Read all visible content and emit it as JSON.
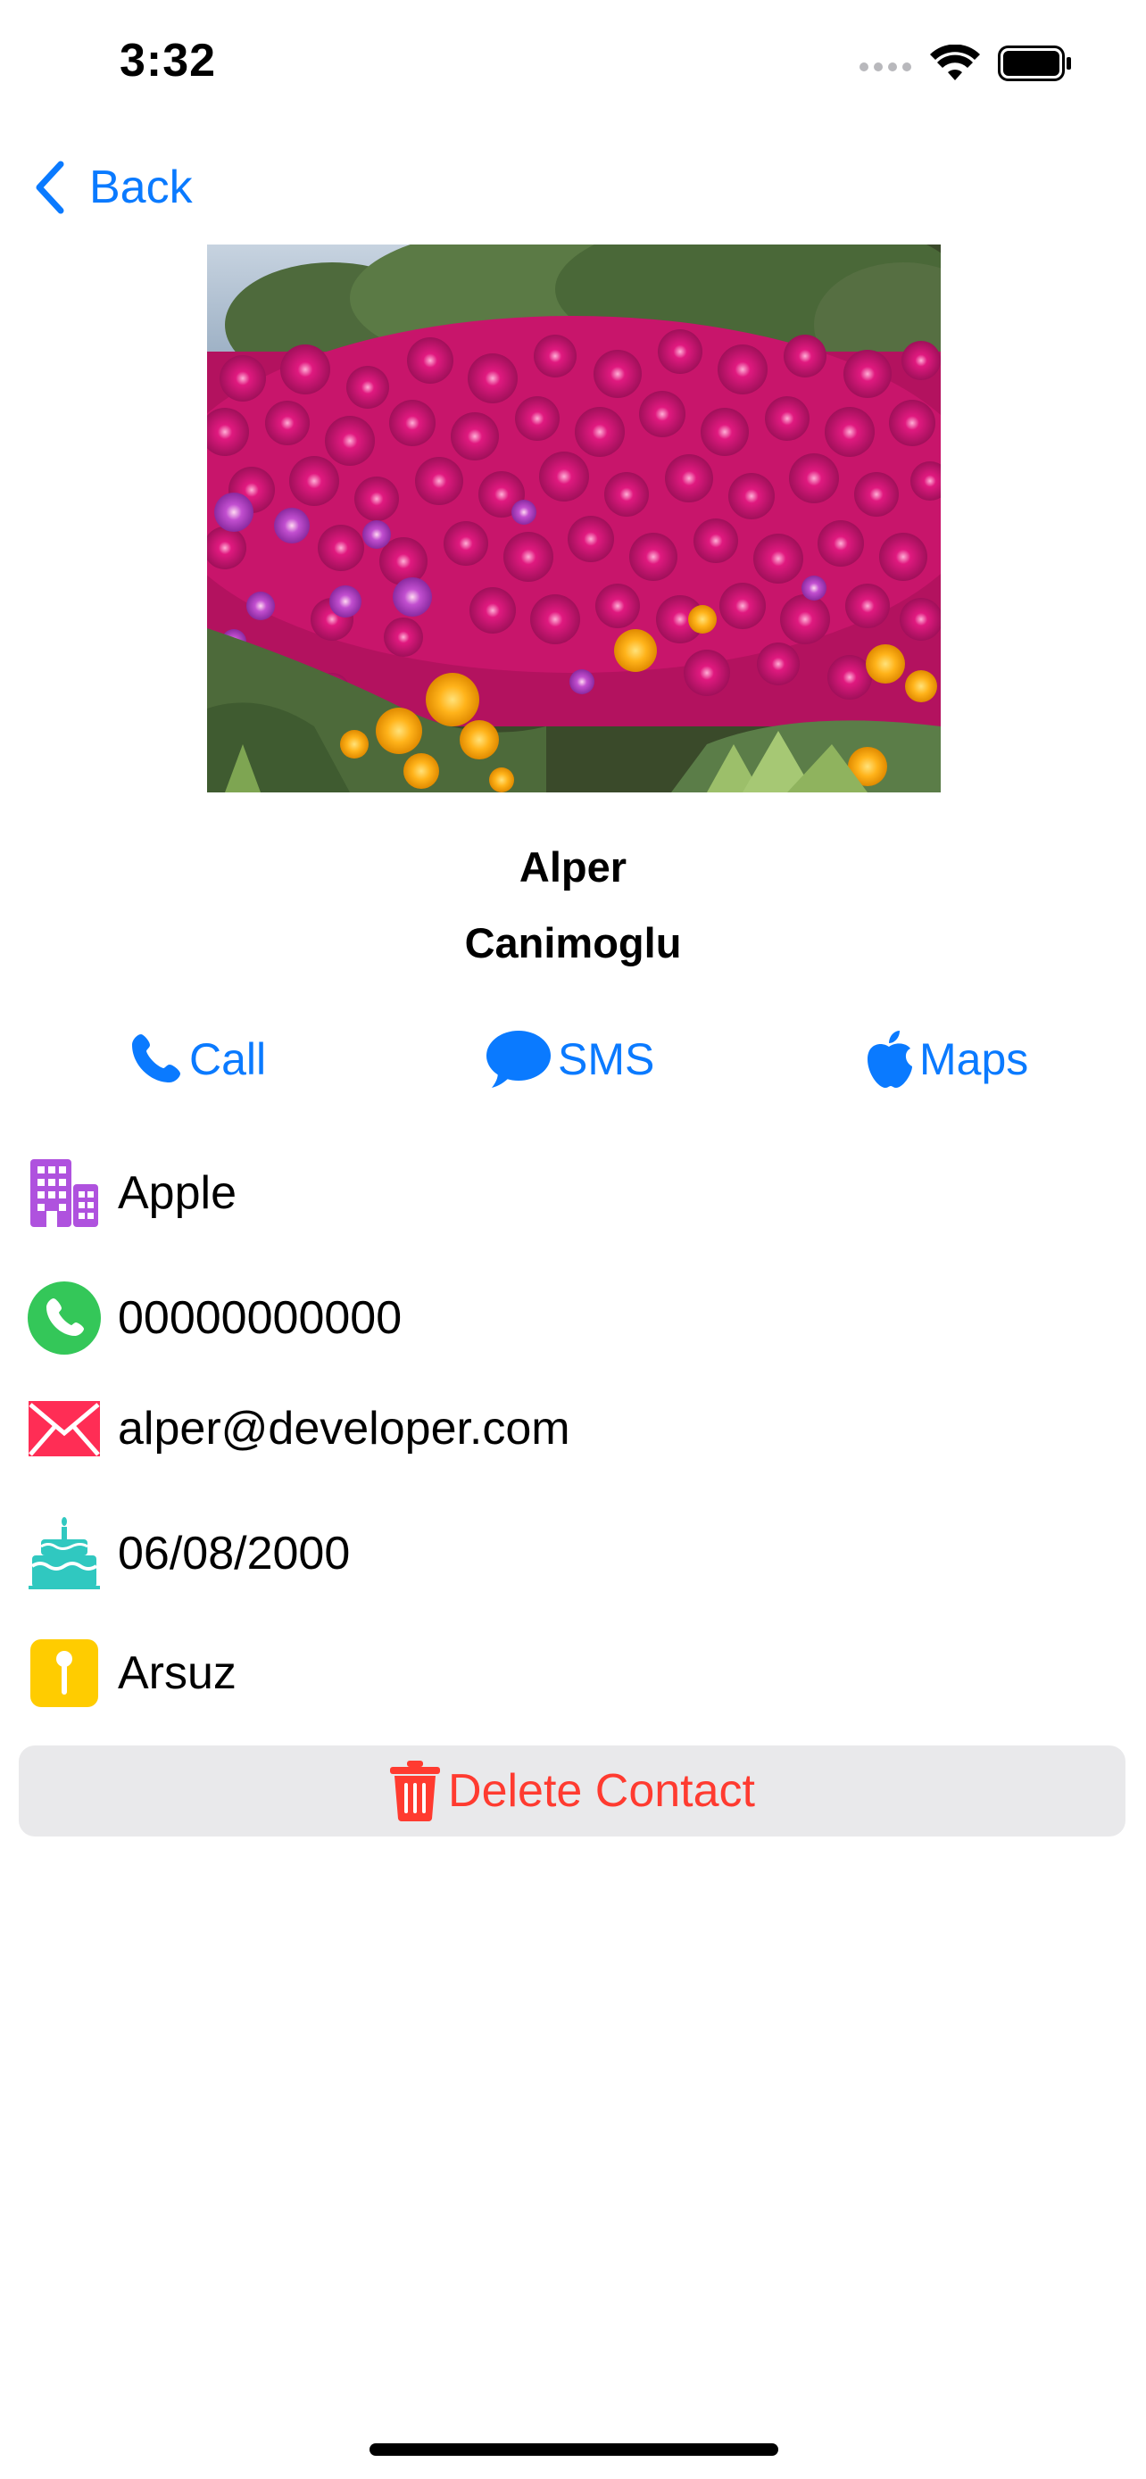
{
  "status_bar": {
    "time": "3:32"
  },
  "nav": {
    "back_label": "Back"
  },
  "contact": {
    "first_name": "Alper",
    "last_name": "Canimoglu"
  },
  "actions": {
    "call_label": "Call",
    "sms_label": "SMS",
    "maps_label": "Maps"
  },
  "details": {
    "company": "Apple",
    "phone": "00000000000",
    "email": "alper@developer.com",
    "birthday": "06/08/2000",
    "location": "Arsuz"
  },
  "delete": {
    "label": "Delete Contact"
  },
  "icons": {
    "back": "chevron-left-icon",
    "call": "phone-icon",
    "sms": "message-bubble-icon",
    "maps": "apple-logo-icon",
    "company": "building-icon",
    "phone": "phone-circle-icon",
    "email": "envelope-icon",
    "birthday": "birthday-cake-icon",
    "location": "pin-icon",
    "delete": "trash-icon"
  },
  "colors": {
    "accent": "#0a7aff",
    "destructive": "#ff3b30",
    "company_icon": "#af52de",
    "phone_icon": "#34c759",
    "email_icon": "#ff2d55",
    "birthday_icon": "#30c8c0",
    "location_icon": "#ffcc00",
    "delete_background": "#e9e9eb"
  }
}
